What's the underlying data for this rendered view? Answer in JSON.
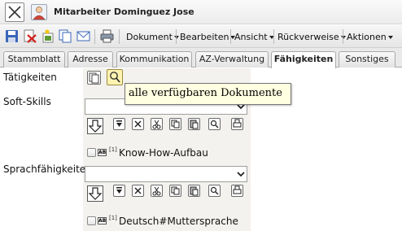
{
  "window": {
    "title": "Mitarbeiter Dominguez Jose"
  },
  "toolbar": {
    "icons": [
      "save-icon",
      "delete-icon",
      "new-document-icon",
      "copy-icon",
      "email-icon",
      "print-icon"
    ],
    "menus": [
      {
        "label": "Dokument"
      },
      {
        "label": "Bearbeiten"
      },
      {
        "label": "Ansicht"
      },
      {
        "label": "Rückverweise"
      },
      {
        "label": "Aktionen"
      }
    ]
  },
  "tabs": [
    {
      "label": "Stammblatt",
      "active": false
    },
    {
      "label": "Adresse",
      "active": false
    },
    {
      "label": "Kommunikation",
      "active": false
    },
    {
      "label": "AZ-Verwaltung",
      "active": false
    },
    {
      "label": "Fähigkeiten",
      "active": true
    },
    {
      "label": "Sonstiges",
      "active": false
    }
  ],
  "form": {
    "taetigkeiten": {
      "label": "Tätigkeiten",
      "tooltip": "alle verfügbaren Dokumente"
    },
    "soft_skills": {
      "label": "Soft-Skills",
      "value": "",
      "items": [
        {
          "marker": "[1]",
          "text": "Know-How-Aufbau",
          "checked": false
        }
      ]
    },
    "sprachfaehigkeiten": {
      "label": "Sprachfähigkeiten",
      "value": "",
      "items": [
        {
          "marker": "[1]",
          "text": "Deutsch#Muttersprache",
          "checked": false
        }
      ]
    }
  },
  "colors": {
    "tooltip_bg": "#ffffe1",
    "active_tab_bg": "#ffffff",
    "toolbar_bg": "#e6e6e6"
  }
}
